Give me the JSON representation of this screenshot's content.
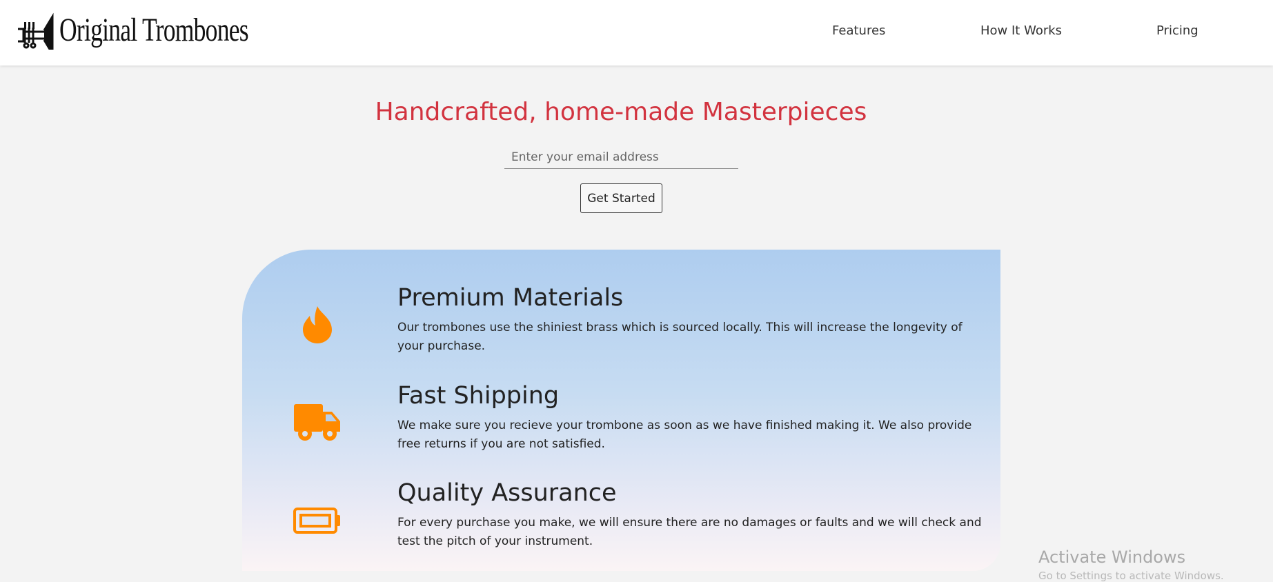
{
  "header": {
    "brand_name": "Original Trombones",
    "nav": [
      {
        "label": "Features"
      },
      {
        "label": "How It Works"
      },
      {
        "label": "Pricing"
      }
    ]
  },
  "hero": {
    "title": "Handcrafted, home-made Masterpieces",
    "email_placeholder": "Enter your email address",
    "email_value": "",
    "cta_label": "Get Started"
  },
  "features": [
    {
      "icon": "fire-icon",
      "title": "Premium Materials",
      "description": "Our trombones use the shiniest brass which is sourced locally. This will increase the longevity of your purchase."
    },
    {
      "icon": "truck-icon",
      "title": "Fast Shipping",
      "description": "We make sure you recieve your trombone as soon as we have finished making it. We also provide free returns if you are not satisfied."
    },
    {
      "icon": "battery-icon",
      "title": "Quality Assurance",
      "description": "For every purchase you make, we will ensure there are no damages or faults and we will check and test the pitch of your instrument."
    }
  ],
  "colors": {
    "accent_title": "#d2333f",
    "icon_orange": "#ff8a00",
    "header_bg": "#ffffff",
    "page_bg": "#f3f3f3"
  },
  "watermark": {
    "title": "Activate Windows",
    "subtitle": "Go to Settings to activate Windows."
  }
}
